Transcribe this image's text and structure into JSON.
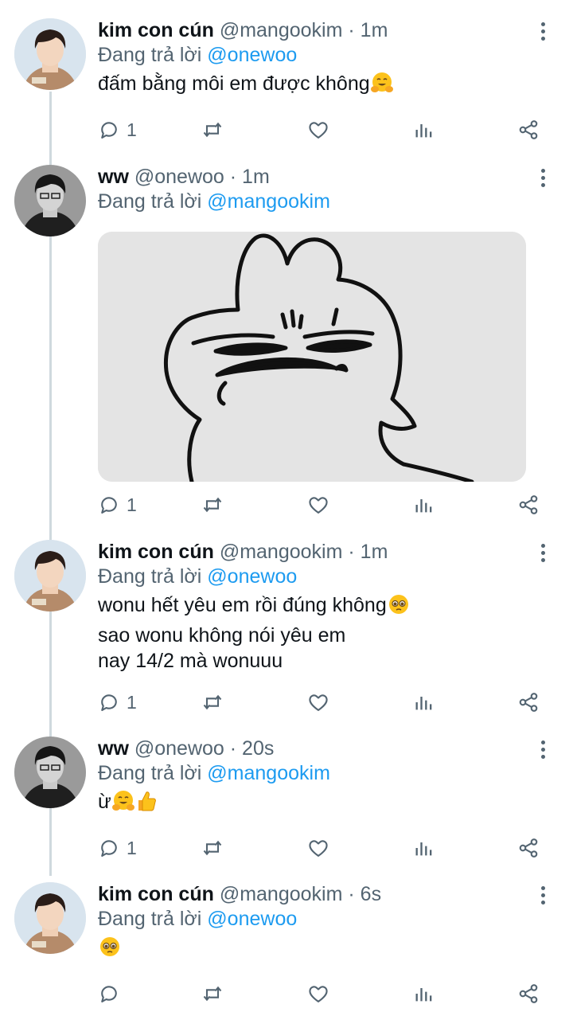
{
  "colors": {
    "text": "#0f1419",
    "secondary": "#536471",
    "link": "#1d9bf0",
    "thread_line": "#cfd9de"
  },
  "tweets": [
    {
      "name": "kim con cún",
      "handle": "@mangookim",
      "dot": "·",
      "time": "1m",
      "reply_prefix": "Đang trả lời",
      "reply_to": "@onewoo",
      "lines": [
        "đấm bằng môi em được không"
      ],
      "line_emojis": [
        [
          "smiling-face-with-open-hands"
        ]
      ],
      "reply_count": "1"
    },
    {
      "name": "ww",
      "handle": "@onewoo",
      "dot": "·",
      "time": "1m",
      "reply_prefix": "Đang trả lời",
      "reply_to": "@mangookim",
      "media": "grumpy-cartoon-sticker",
      "reply_count": "1"
    },
    {
      "name": "kim con cún",
      "handle": "@mangookim",
      "dot": "·",
      "time": "1m",
      "reply_prefix": "Đang trả lời",
      "reply_to": "@onewoo",
      "lines": [
        "wonu hết yêu em rồi đúng không",
        "sao wonu không nói yêu em",
        "nay 14/2 mà wonuuu"
      ],
      "line_emojis": [
        [
          "pleading-face"
        ],
        [],
        []
      ],
      "reply_count": "1"
    },
    {
      "name": "ww",
      "handle": "@onewoo",
      "dot": "·",
      "time": "20s",
      "reply_prefix": "Đang trả lời",
      "reply_to": "@mangookim",
      "lines": [
        "ừ"
      ],
      "line_emojis": [
        [
          "smiling-face-with-open-hands",
          "thumbs-up"
        ]
      ],
      "reply_count": "1"
    },
    {
      "name": "kim con cún",
      "handle": "@mangookim",
      "dot": "·",
      "time": "6s",
      "reply_prefix": "Đang trả lời",
      "reply_to": "@onewoo",
      "lines": [
        ""
      ],
      "line_emojis": [
        [
          "pleading-face"
        ]
      ],
      "reply_count": ""
    }
  ],
  "icons": {
    "reply": "reply-icon",
    "retweet": "retweet-icon",
    "like": "heart-icon",
    "stats": "analytics-icon",
    "share": "share-icon",
    "more": "more-options-icon"
  }
}
